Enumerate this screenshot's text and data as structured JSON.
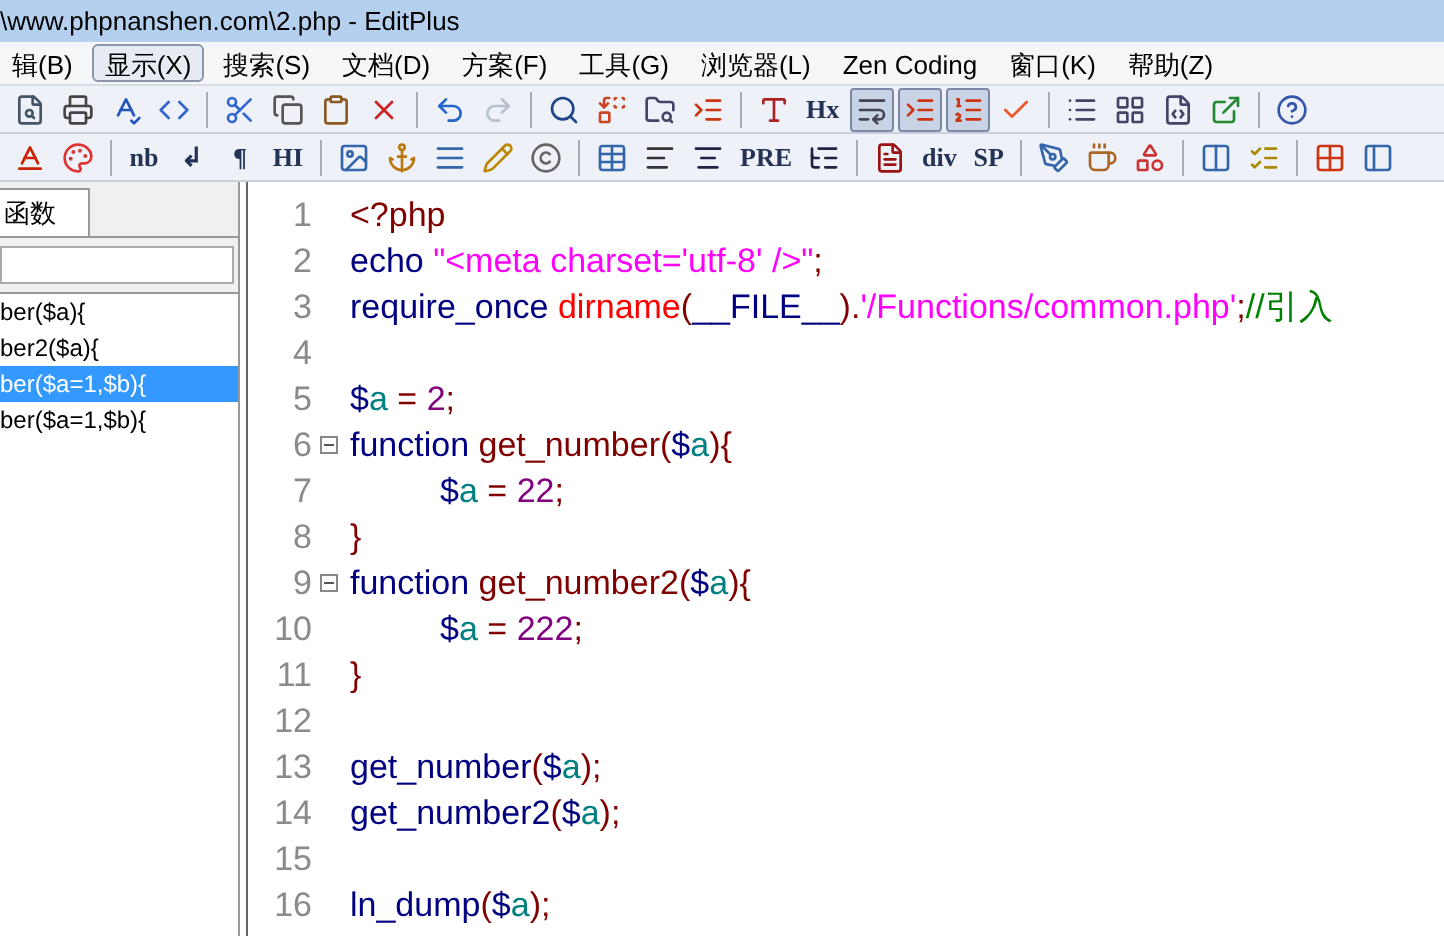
{
  "window": {
    "title": "\\www.phpnanshen.com\\2.php - EditPlus"
  },
  "menu": [
    {
      "label": "辑(B)",
      "selected": false
    },
    {
      "label": "显示(X)",
      "selected": true
    },
    {
      "label": "搜索(S)",
      "selected": false
    },
    {
      "label": "文档(D)",
      "selected": false
    },
    {
      "label": "方案(F)",
      "selected": false
    },
    {
      "label": "工具(G)",
      "selected": false
    },
    {
      "label": "浏览器(L)",
      "selected": false
    },
    {
      "label": "Zen Coding",
      "selected": false
    },
    {
      "label": "窗口(K)",
      "selected": false
    },
    {
      "label": "帮助(Z)",
      "selected": false
    }
  ],
  "toolbar_1": [
    {
      "kind": "icon"
    },
    {
      "kind": "icon"
    },
    {
      "kind": "icon"
    },
    {
      "kind": "icon"
    },
    {
      "kind": "sep"
    },
    {
      "kind": "icon"
    },
    {
      "kind": "icon"
    },
    {
      "kind": "icon"
    },
    {
      "kind": "icon"
    },
    {
      "kind": "sep"
    },
    {
      "kind": "icon",
      "disabled": false
    },
    {
      "kind": "icon",
      "disabled": true
    },
    {
      "kind": "sep"
    },
    {
      "kind": "icon"
    },
    {
      "kind": "icon"
    },
    {
      "kind": "icon"
    },
    {
      "kind": "icon"
    },
    {
      "kind": "sep"
    },
    {
      "kind": "icon"
    },
    {
      "kind": "text",
      "label": "Hx"
    },
    {
      "kind": "icon",
      "pressed": true
    },
    {
      "kind": "icon",
      "pressed": true
    },
    {
      "kind": "icon",
      "pressed": true
    },
    {
      "kind": "icon"
    },
    {
      "kind": "sep"
    },
    {
      "kind": "icon"
    },
    {
      "kind": "icon"
    },
    {
      "kind": "icon"
    },
    {
      "kind": "icon"
    },
    {
      "kind": "sep"
    },
    {
      "kind": "icon"
    }
  ],
  "toolbar_2": [
    {
      "kind": "icon"
    },
    {
      "kind": "icon"
    },
    {
      "kind": "sep"
    },
    {
      "kind": "text",
      "label": "nb"
    },
    {
      "kind": "text",
      "label": "↲"
    },
    {
      "kind": "text",
      "label": "¶"
    },
    {
      "kind": "text",
      "label": "HI"
    },
    {
      "kind": "sep"
    },
    {
      "kind": "icon"
    },
    {
      "kind": "icon"
    },
    {
      "kind": "icon"
    },
    {
      "kind": "icon"
    },
    {
      "kind": "icon"
    },
    {
      "kind": "sep"
    },
    {
      "kind": "icon"
    },
    {
      "kind": "icon"
    },
    {
      "kind": "icon"
    },
    {
      "kind": "text",
      "label": "PRE"
    },
    {
      "kind": "icon"
    },
    {
      "kind": "sep"
    },
    {
      "kind": "icon"
    },
    {
      "kind": "text",
      "label": "div"
    },
    {
      "kind": "text",
      "label": "SP"
    },
    {
      "kind": "sep"
    },
    {
      "kind": "icon"
    },
    {
      "kind": "icon"
    },
    {
      "kind": "icon"
    },
    {
      "kind": "sep"
    },
    {
      "kind": "icon"
    },
    {
      "kind": "icon"
    },
    {
      "kind": "sep"
    },
    {
      "kind": "icon"
    },
    {
      "kind": "icon"
    }
  ],
  "sidebar": {
    "tab": {
      "label": "函数",
      "selected": true
    },
    "items": [
      {
        "label": "ber($a){",
        "selected": false
      },
      {
        "label": "ber2($a){",
        "selected": false
      },
      {
        "label": "ber($a=1,$b){",
        "selected": true
      },
      {
        "label": "ber($a=1,$b){",
        "selected": false
      }
    ]
  },
  "editor": {
    "lines": [
      {
        "number": "1",
        "tokens": [
          {
            "kind": "tag",
            "text": "<?php"
          }
        ]
      },
      {
        "number": "2",
        "tokens": [
          {
            "kind": "kw",
            "text": "echo "
          },
          {
            "kind": "str",
            "text": "\"<meta charset='utf-8' />\""
          },
          {
            "kind": "op",
            "text": ";"
          }
        ]
      },
      {
        "number": "3",
        "tokens": [
          {
            "kind": "kw",
            "text": "require_once "
          },
          {
            "kind": "builtin",
            "text": "dirname"
          },
          {
            "kind": "op",
            "text": "("
          },
          {
            "kind": "kw",
            "text": "__FILE__"
          },
          {
            "kind": "op",
            "text": ")."
          },
          {
            "kind": "str",
            "text": "'/Functions/common.php'"
          },
          {
            "kind": "op",
            "text": ";"
          },
          {
            "kind": "comment",
            "text": "//引入"
          }
        ]
      },
      {
        "number": "4"
      },
      {
        "number": "5",
        "tokens": [
          {
            "kind": "kw",
            "text": "$"
          },
          {
            "kind": "var",
            "text": "a"
          },
          {
            "kind": "op",
            "text": " = "
          },
          {
            "kind": "num",
            "text": "2"
          },
          {
            "kind": "op",
            "text": ";"
          }
        ]
      },
      {
        "number": "6",
        "tokens": [
          {
            "kind": "kw",
            "text": "function "
          },
          {
            "kind": "func",
            "text": "get_number"
          },
          {
            "kind": "op",
            "text": "("
          },
          {
            "kind": "kw",
            "text": "$"
          },
          {
            "kind": "var",
            "text": "a"
          },
          {
            "kind": "op",
            "text": "){"
          }
        ],
        "children": [
          {
            "number": "7",
            "tokens": [
              {
                "kind": "kw",
                "text": "$"
              },
              {
                "kind": "var",
                "text": "a"
              },
              {
                "kind": "op",
                "text": " = "
              },
              {
                "kind": "num",
                "text": "22"
              },
              {
                "kind": "op",
                "text": ";"
              }
            ]
          }
        ]
      },
      {
        "number": "8",
        "tokens": [
          {
            "kind": "op",
            "text": "}"
          }
        ]
      },
      {
        "number": "9",
        "tokens": [
          {
            "kind": "kw",
            "text": "function "
          },
          {
            "kind": "func",
            "text": "get_number2"
          },
          {
            "kind": "op",
            "text": "("
          },
          {
            "kind": "kw",
            "text": "$"
          },
          {
            "kind": "var",
            "text": "a"
          },
          {
            "kind": "op",
            "text": "){"
          }
        ],
        "children": [
          {
            "number": "10",
            "tokens": [
              {
                "kind": "kw",
                "text": "$"
              },
              {
                "kind": "var",
                "text": "a"
              },
              {
                "kind": "op",
                "text": " = "
              },
              {
                "kind": "num",
                "text": "222"
              },
              {
                "kind": "op",
                "text": ";"
              }
            ]
          }
        ]
      },
      {
        "number": "11",
        "tokens": [
          {
            "kind": "op",
            "text": "}"
          }
        ]
      },
      {
        "number": "12"
      },
      {
        "number": "13",
        "tokens": [
          {
            "kind": "kw",
            "text": "get_number"
          },
          {
            "kind": "op",
            "text": "("
          },
          {
            "kind": "kw",
            "text": "$"
          },
          {
            "kind": "var",
            "text": "a"
          },
          {
            "kind": "op",
            "text": ");"
          }
        ]
      },
      {
        "number": "14",
        "tokens": [
          {
            "kind": "kw",
            "text": "get_number2"
          },
          {
            "kind": "op",
            "text": "("
          },
          {
            "kind": "kw",
            "text": "$"
          },
          {
            "kind": "var",
            "text": "a"
          },
          {
            "kind": "op",
            "text": ");"
          }
        ]
      },
      {
        "number": "15"
      },
      {
        "number": "16",
        "tokens": [
          {
            "kind": "kw",
            "text": "ln_dump"
          },
          {
            "kind": "op",
            "text": "("
          },
          {
            "kind": "kw",
            "text": "$"
          },
          {
            "kind": "var",
            "text": "a"
          },
          {
            "kind": "op",
            "text": ");"
          }
        ]
      }
    ]
  }
}
